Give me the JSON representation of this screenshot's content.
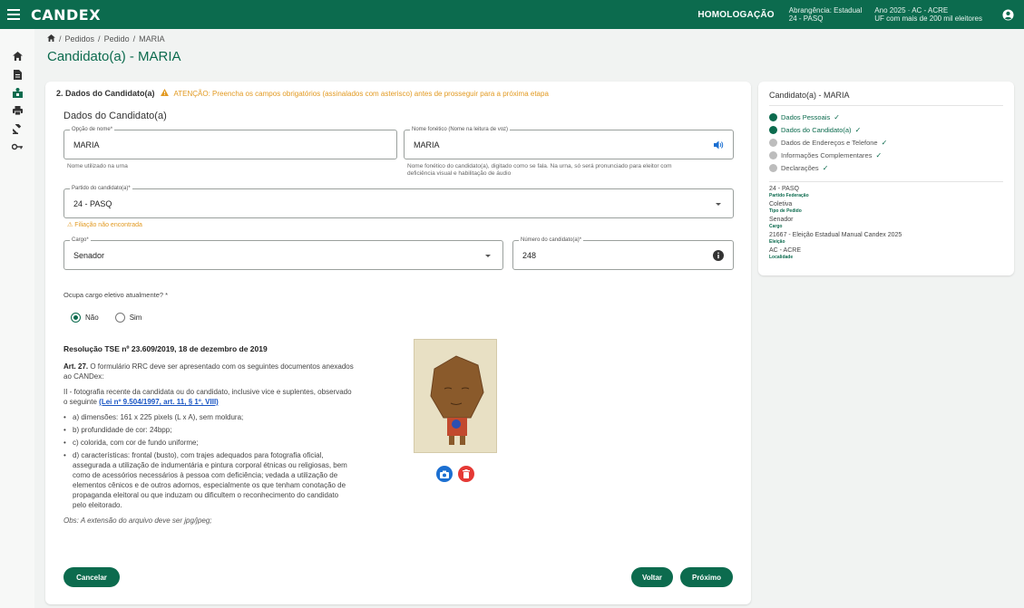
{
  "header": {
    "logo": "CANDEX",
    "environment": "HOMOLOGAÇÃO",
    "scope_line1": "Abrangência: Estadual",
    "scope_line2": "24 - PASQ",
    "year_line1": "Ano 2025 · AC - ACRE",
    "year_line2": "UF com mais de 200 mil eleitores"
  },
  "breadcrumb": {
    "items": [
      "Pedidos",
      "Pedido",
      "MARIA"
    ],
    "sep": "/"
  },
  "page_title": "Candidato(a) - MARIA",
  "form": {
    "section_title": "2. Dados do Candidato(a)",
    "warning": "ATENÇÃO: Preencha os campos obrigatórios (assinalados com asterisco) antes de prosseguir para a próxima etapa",
    "subtitle": "Dados do Candidato(a)",
    "urn_name": {
      "label": "Opção de nome*",
      "value": "MARIA",
      "hint": "Nome utilizado na urna"
    },
    "phonetic_name": {
      "label": "Nome fonético (Nome na leitura de voz)",
      "value": "MARIA",
      "hint_line1": "Nome fonético do candidato(a), digitado como se fala. Na urna, só será pronunciado para eleitor com",
      "hint_line2": "deficiência visual e habilitação de áudio"
    },
    "party": {
      "label": "Partido do candidato(a)*",
      "value": "24 - PASQ",
      "warning": "Filiação não encontrada"
    },
    "office": {
      "label": "Cargo*",
      "value": "Senador"
    },
    "number": {
      "label": "Número do candidato(a)*",
      "value": "248"
    },
    "elected_question": "Ocupa cargo eletivo atualmente? *",
    "radio_no": "Não",
    "radio_yes": "Sim",
    "selected": "no"
  },
  "resolution": {
    "title": "Resolução TSE nº 23.609/2019, 18 de dezembro de 2019",
    "art_label": "Art. 27.",
    "art_text": "O formulário RRC deve ser apresentado com os seguintes documentos anexados ao CANDex:",
    "item_intro": "II - fotografia recente da candidata ou do candidato, inclusive vice e suplentes, observado o seguinte",
    "law_link": "(Lei nº 9.504/1997, art. 11, § 1º, VIII)",
    "list": [
      "a) dimensões: 161 x 225 pixels (L x A), sem moldura;",
      "b) profundidade de cor: 24bpp;",
      "c) colorida, com cor de fundo uniforme;",
      "d) características: frontal (busto), com trajes adequados para fotografia oficial, assegurada a utilização de indumentária e pintura corporal étnicas ou religiosas, bem como de acessórios necessários à pessoa com deficiência; vedada a utilização de elementos cênicos e de outros adornos, especialmente os que tenham conotação de propaganda eleitoral ou que induzam ou dificultem o reconhecimento do candidato pelo eleitorado."
    ],
    "obs": "Obs: A extensão do arquivo deve ser jpg/jpeg;"
  },
  "buttons": {
    "cancel": "Cancelar",
    "back": "Voltar",
    "next": "Próximo"
  },
  "sidebar": {
    "title": "Candidato(a) - MARIA",
    "steps": [
      {
        "label": "Dados Pessoais",
        "status": "done"
      },
      {
        "label": "Dados do Candidato(a)",
        "status": "done"
      },
      {
        "label": "Dados de Endereços e Telefone",
        "status": "pending"
      },
      {
        "label": "Informações Complementares",
        "status": "pending"
      },
      {
        "label": "Declarações",
        "status": "pending"
      }
    ],
    "summary": [
      {
        "value": "24 - PASQ",
        "label": "Partido Federação"
      },
      {
        "value": "Coletiva",
        "label": "Tipo de Pedido"
      },
      {
        "value": "Senador",
        "label": "Cargo"
      },
      {
        "value": "21667 - Eleição Estadual Manual Candex 2025",
        "label": "Eleição"
      },
      {
        "value": "AC - ACRE",
        "label": "Localidade"
      }
    ]
  },
  "colors": {
    "primary": "#0c6b4e",
    "warning": "#e29a22",
    "link": "#1a56c4",
    "camera_button": "#1b6fd1",
    "delete_button": "#e53935"
  },
  "icons": {
    "menu": "menu-icon",
    "user": "account-circle-icon",
    "home": "home-icon",
    "speaker": "volume-icon",
    "info": "info-icon",
    "dropdown": "chevron-down-icon",
    "camera": "camera-icon",
    "delete": "trash-icon"
  }
}
